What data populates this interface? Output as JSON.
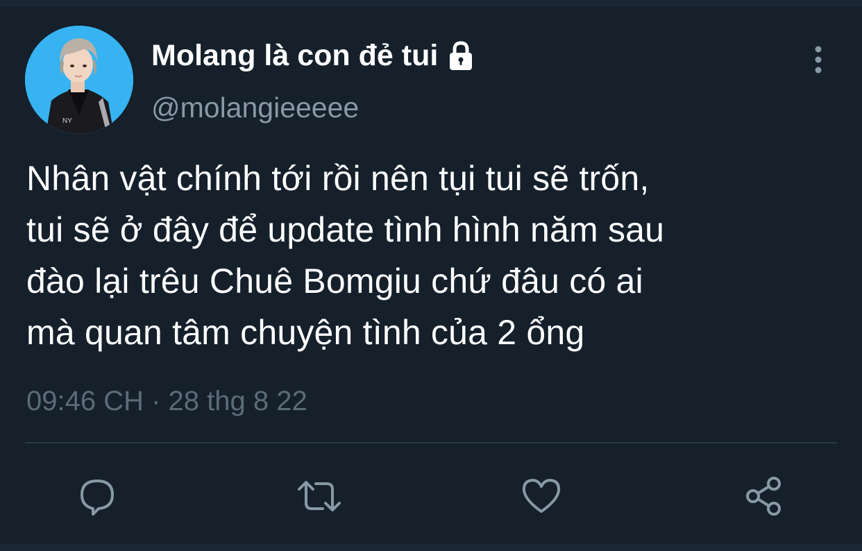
{
  "tweet": {
    "author": {
      "display_name": "Molang là con đẻ tui",
      "handle": "@molangieeeee",
      "locked_icon": "lock-icon",
      "avatar_bg": "#37b3f2"
    },
    "text_lines": [
      "Nhân vật chính tới rồi nên tụi tui sẽ trốn,",
      "tui sẽ ở đây để update tình hình năm sau",
      "đào lại trêu Chuê Bomgiu chứ đâu có ai",
      "mà quan tâm chuyện tình của 2 ổng"
    ],
    "timestamp": "09:46 CH · 28 thg 8 22"
  },
  "menu": {
    "icon": "more-vertical-icon"
  },
  "actions": [
    {
      "name": "reply",
      "icon": "reply-icon"
    },
    {
      "name": "retweet",
      "icon": "retweet-icon"
    },
    {
      "name": "like",
      "icon": "heart-icon"
    },
    {
      "name": "share",
      "icon": "share-icon"
    }
  ],
  "colors": {
    "background": "#15202b",
    "text": "#ffffff",
    "secondary": "#8899a6",
    "muted": "#5b6b78",
    "divider": "#2c3a46",
    "icon": "#8899a6"
  }
}
